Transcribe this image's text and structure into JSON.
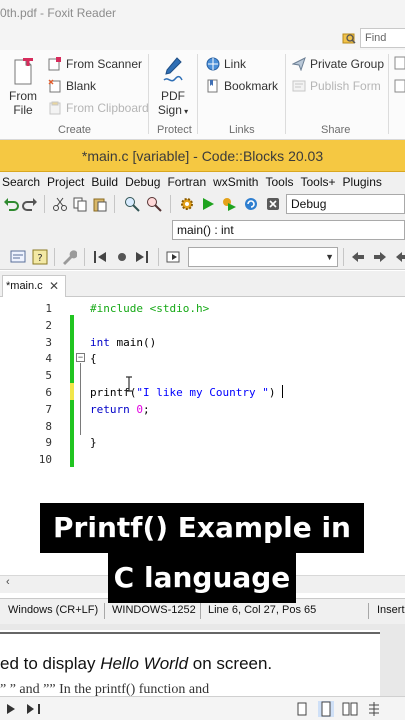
{
  "foxit": {
    "window_title": "0th.pdf - Foxit Reader",
    "find_placeholder": "Find",
    "ribbon": {
      "create": {
        "from_file": [
          "From",
          "File"
        ],
        "from_scanner": "From Scanner",
        "blank": "Blank",
        "from_clipboard": "From Clipboard",
        "label": "Create"
      },
      "protect": {
        "pdf_sign": [
          "PDF",
          "Sign"
        ],
        "label": "Protect"
      },
      "links": {
        "link": "Link",
        "bookmark": "Bookmark",
        "label": "Links"
      },
      "share": {
        "private_group": "Private Group",
        "publish_form": "Publish Form",
        "label": "Share"
      }
    },
    "page_text": {
      "line1_prefix": "ed to display ",
      "line1_italic": "Hello World",
      "line1_suffix": " on screen.",
      "line2": "” ” and ”” In the printf() function and"
    }
  },
  "codeblocks": {
    "title": "*main.c [variable] - Code::Blocks 20.03",
    "menu": [
      "Search",
      "Project",
      "Build",
      "Debug",
      "Fortran",
      "wxSmith",
      "Tools",
      "Tools+",
      "Plugins"
    ],
    "build_target": "Debug",
    "scope_combo": "main() : int",
    "tab_label": "*main.c",
    "tab_close": "✕",
    "code_lines": [
      {
        "n": "1",
        "parts": [
          {
            "t": "#include <stdio.h>",
            "c": "pp"
          }
        ]
      },
      {
        "n": "2",
        "parts": []
      },
      {
        "n": "3",
        "parts": [
          {
            "t": "int",
            "c": "kw"
          },
          {
            "t": " main()",
            "c": "brace"
          }
        ]
      },
      {
        "n": "4",
        "parts": [
          {
            "t": "{",
            "c": "brace"
          }
        ]
      },
      {
        "n": "5",
        "parts": []
      },
      {
        "n": "6",
        "parts": [
          {
            "t": "printf(",
            "c": "brace"
          },
          {
            "t": "\"I like my Country \"",
            "c": "str"
          },
          {
            "t": ")",
            "c": "brace"
          }
        ]
      },
      {
        "n": "7",
        "parts": [
          {
            "t": "return",
            "c": "kw"
          },
          {
            "t": " ",
            "c": "brace"
          },
          {
            "t": "0",
            "c": "num"
          },
          {
            "t": ";",
            "c": "brace"
          }
        ]
      },
      {
        "n": "8",
        "parts": []
      },
      {
        "n": "9",
        "parts": [
          {
            "t": "}",
            "c": "brace"
          }
        ]
      },
      {
        "n": "10",
        "parts": []
      }
    ],
    "status": {
      "eol": "Windows (CR+LF)",
      "encoding": "WINDOWS-1252",
      "position": "Line 6, Col 27, Pos 65",
      "mode": "Insert"
    }
  },
  "caption": {
    "line1": "Printf() Example in",
    "line2": "C language"
  },
  "colors": {
    "cb_title_bg": "#f5c842",
    "change_saved": "#21c521",
    "change_unsaved": "#f1e64a"
  }
}
